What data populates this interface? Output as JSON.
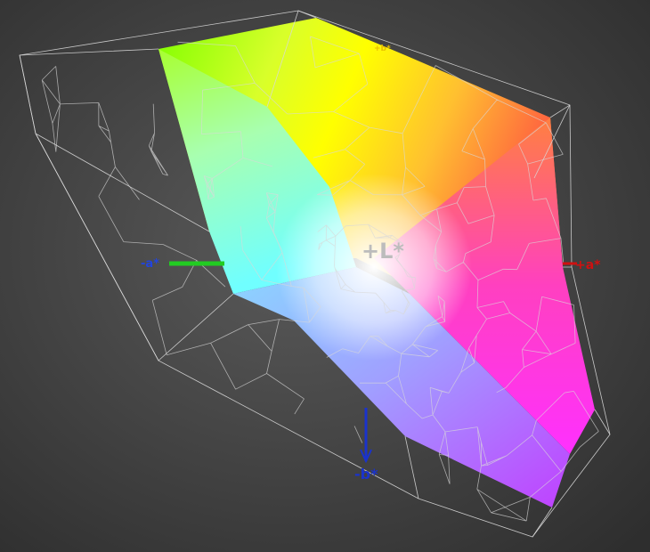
{
  "gamut_view": {
    "labels": {
      "l_axis": "+L*",
      "a_pos": "+a*",
      "a_neg": "-a*",
      "b_neg": "-b*",
      "b_pos": "+b*"
    },
    "colors": {
      "background_center": "#5a5a5a",
      "background_edge": "#2e2e2e",
      "wireframe": "#d8d8d8",
      "l_label": "#bcbcbc",
      "a_pos_axis": "#d01010",
      "a_neg_axis": "#22cc22",
      "a_neg_label": "#2244dd",
      "b_neg_axis": "#1a33cc",
      "b_pos_label": "#e8c000"
    }
  }
}
